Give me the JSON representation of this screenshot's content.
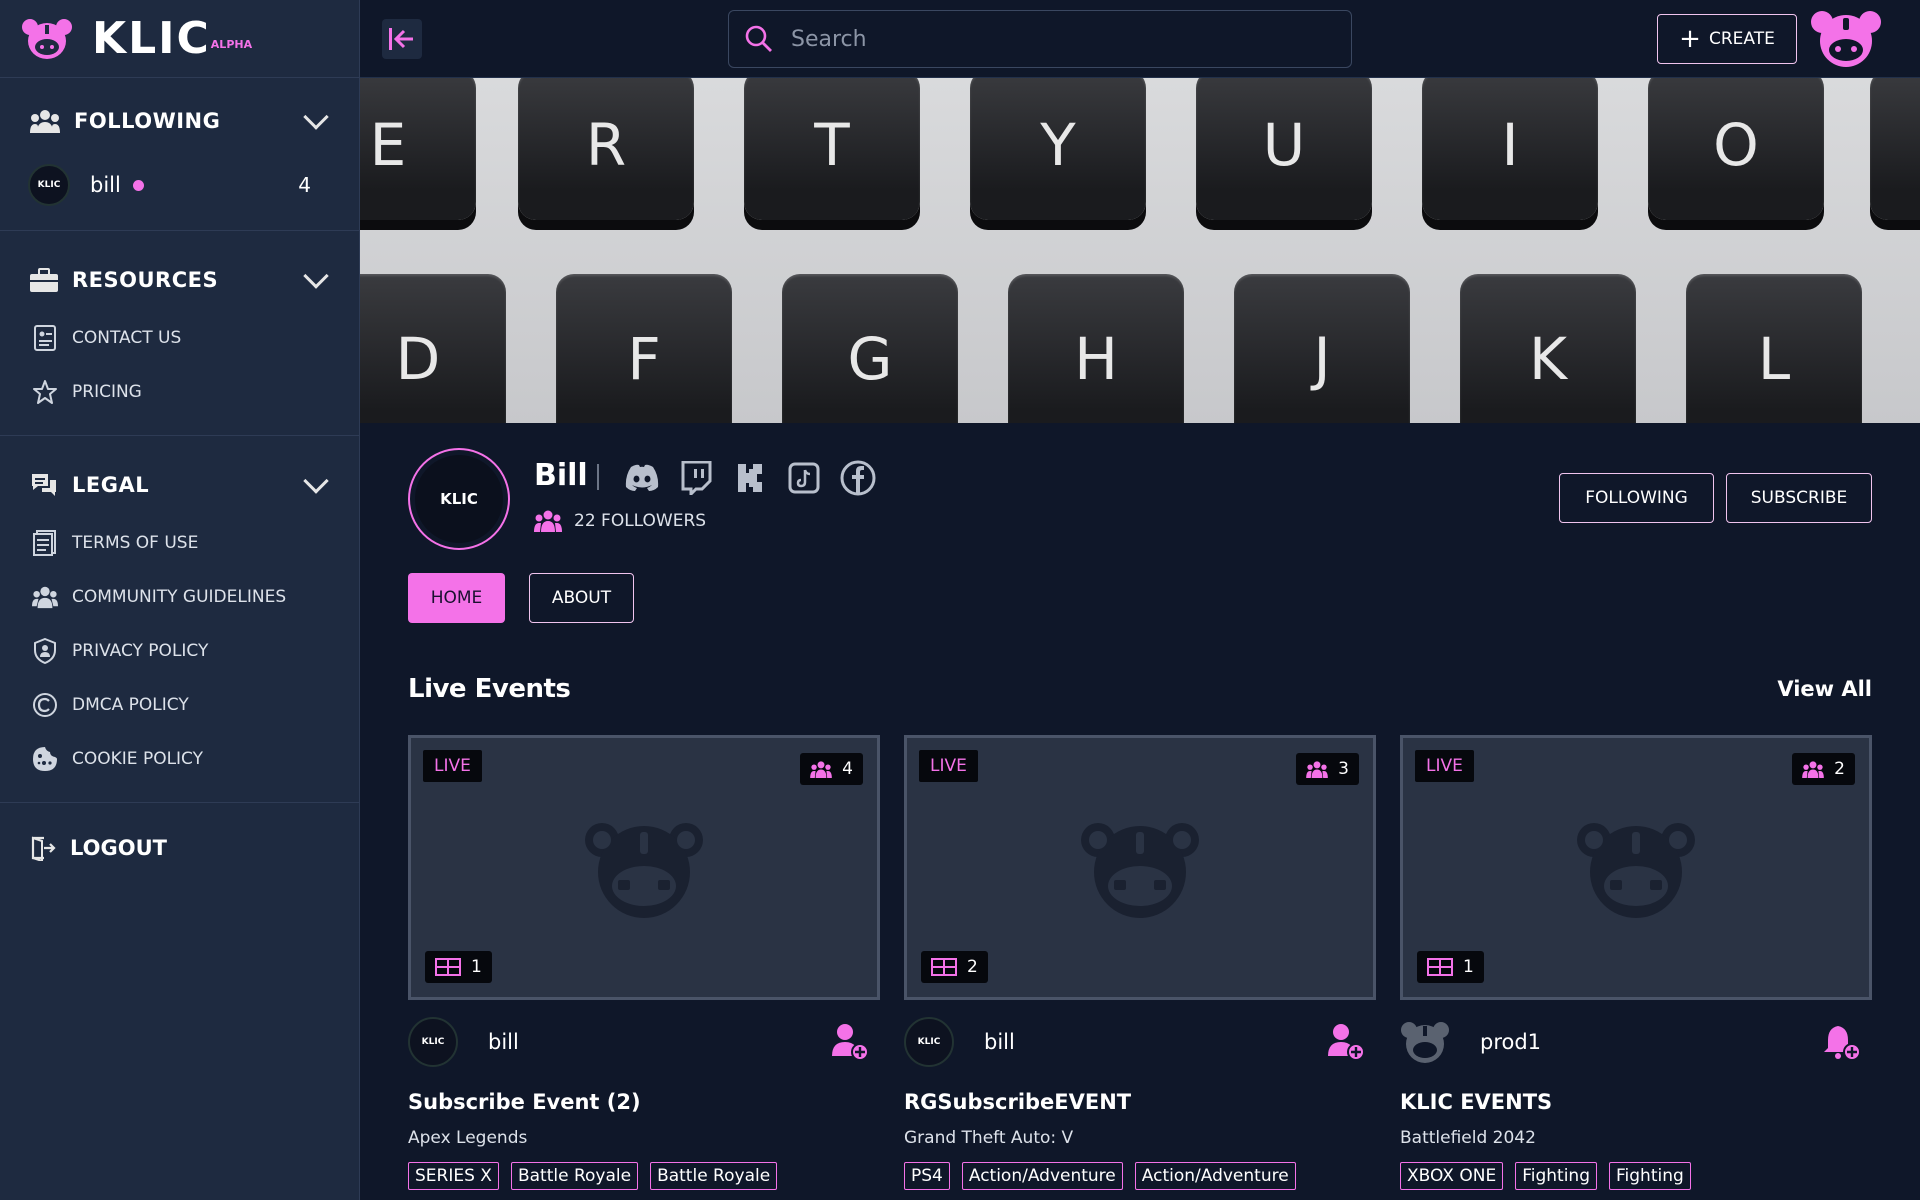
{
  "brand": {
    "name": "KLIC",
    "badge": "ALPHA",
    "accent": "#f472e8"
  },
  "sidebar": {
    "following": {
      "title": "FOLLOWING",
      "items": [
        {
          "name": "bill",
          "count": "4",
          "live": true
        }
      ]
    },
    "resources": {
      "title": "RESOURCES",
      "items": [
        {
          "label": "CONTACT US",
          "icon": "contact-card-icon"
        },
        {
          "label": "PRICING",
          "icon": "star-icon"
        }
      ]
    },
    "legal": {
      "title": "LEGAL",
      "items": [
        {
          "label": "TERMS OF USE",
          "icon": "document-icon"
        },
        {
          "label": "COMMUNITY GUIDELINES",
          "icon": "community-icon"
        },
        {
          "label": "PRIVACY POLICY",
          "icon": "shield-user-icon"
        },
        {
          "label": "DMCA POLICY",
          "icon": "copyright-icon"
        },
        {
          "label": "COOKIE POLICY",
          "icon": "cookie-icon"
        }
      ]
    },
    "logout": "LOGOUT"
  },
  "topbar": {
    "search_placeholder": "Search",
    "create_label": "CREATE"
  },
  "banner": {
    "row1": [
      "E",
      "R",
      "T",
      "Y",
      "U",
      "I",
      "O"
    ],
    "row2": [
      "D",
      "F",
      "G",
      "H",
      "J",
      "K",
      "L"
    ]
  },
  "profile": {
    "name": "Bill",
    "avatar_text": "KLIC",
    "followers": "22 FOLLOWERS",
    "socials": [
      "discord-icon",
      "twitch-icon",
      "kick-icon",
      "tiktok-icon",
      "facebook-icon"
    ],
    "following_label": "FOLLOWING",
    "subscribe_label": "SUBSCRIBE",
    "tabs": {
      "home": "HOME",
      "about": "ABOUT"
    }
  },
  "live_events": {
    "title": "Live Events",
    "view_all": "View All",
    "cards": [
      {
        "live": "LIVE",
        "viewers": "4",
        "screens": "1",
        "host": "bill",
        "host_avatar": "KLIC",
        "action": "follow",
        "title": "Subscribe Event (2)",
        "game": "Apex Legends",
        "tags": [
          "SERIES X",
          "Battle Royale",
          "Battle Royale"
        ]
      },
      {
        "live": "LIVE",
        "viewers": "3",
        "screens": "2",
        "host": "bill",
        "host_avatar": "KLIC",
        "action": "follow",
        "title": "RGSubscribeEVENT",
        "game": "Grand Theft Auto: V",
        "tags": [
          "PS4",
          "Action/Adventure",
          "Action/Adventure"
        ]
      },
      {
        "live": "LIVE",
        "viewers": "2",
        "screens": "1",
        "host": "prod1",
        "host_avatar": "",
        "action": "notify",
        "title": "KLIC EVENTS",
        "game": "Battlefield 2042",
        "tags": [
          "XBOX ONE",
          "Fighting",
          "Fighting"
        ]
      }
    ]
  }
}
